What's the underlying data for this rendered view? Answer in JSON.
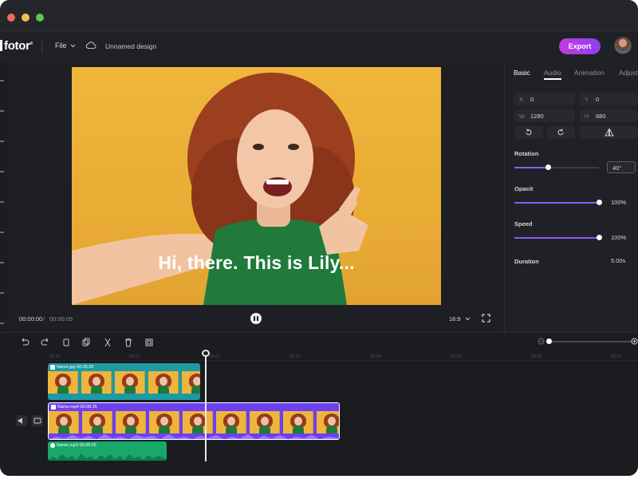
{
  "window": {
    "traffic_lights": [
      "close",
      "minimize",
      "maximize"
    ]
  },
  "toolbar": {
    "logo_text": "fotor",
    "logo_mark": "®",
    "file_menu": "File",
    "design_name": "Unnamed design",
    "export_label": "Export",
    "icons": [
      "chevron-down-icon",
      "cloud-icon"
    ]
  },
  "canvas": {
    "caption": "Hi, there. This is Lily...",
    "time_current": "00:00:00",
    "time_separator": "/",
    "time_total": "00:00:05",
    "aspect_ratio": "16:9",
    "background_color": "#f0b63c"
  },
  "panel": {
    "tabs": [
      "Basic",
      "Audio",
      "Animation",
      "Adjust"
    ],
    "active_tab": "Basic",
    "x_label": "X",
    "x_value": "0",
    "y_label": "Y",
    "y_value": "0",
    "w_label": "W",
    "w_value": "1280",
    "h_label": "H",
    "h_value": "680",
    "rotation_label": "Rotation",
    "rotation_value": "40°",
    "rotation_level": 0.4,
    "opacity_label": "Opacit",
    "opacity_value": "100%",
    "opacity_level": 1.0,
    "speed_label": "Speed",
    "speed_value": "100%",
    "speed_level": 1.0,
    "duration_label": "Duration",
    "duration_value": "5.00s",
    "accent_color": "#8b5cf6"
  },
  "timeline": {
    "ruler": [
      "00:00",
      "00:01",
      "00:02",
      "00:03",
      "00:04",
      "00:05",
      "00:06",
      "00:07"
    ],
    "image_clip": {
      "name": "Name.jpg",
      "duration": "00:05:25",
      "color": "#1d9aa3"
    },
    "video_clip": {
      "name": "Name.mp4",
      "duration": "00:08:25",
      "color": "#6e3ff0"
    },
    "audio_clip": {
      "name": "Name.mp3",
      "duration": "00:08:25",
      "color": "#17a86a"
    }
  }
}
